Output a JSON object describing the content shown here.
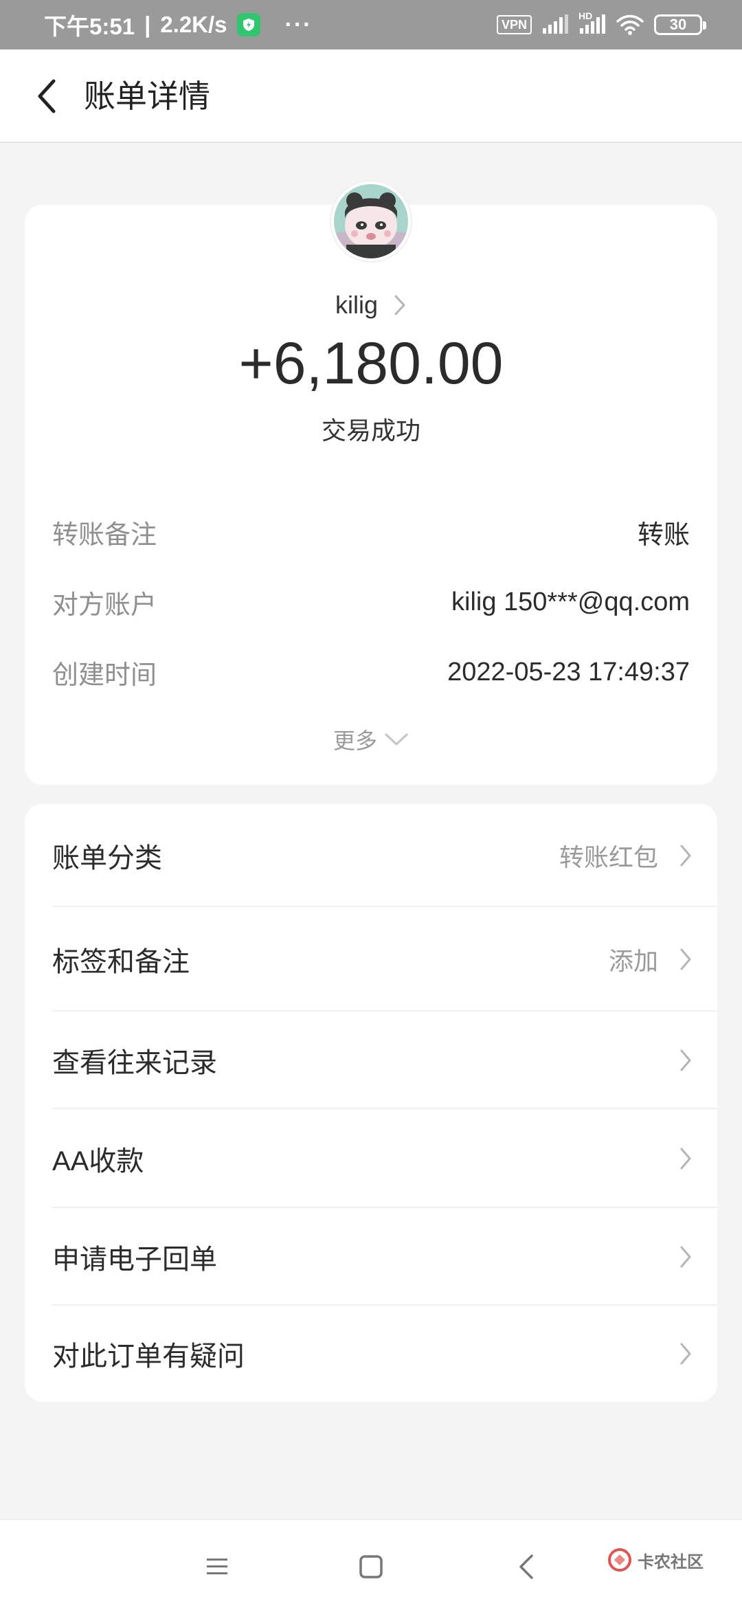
{
  "status_bar": {
    "time": "下午5:51",
    "speed": "2.2K/s",
    "vpn": "VPN",
    "hd": "HD",
    "battery": "30"
  },
  "header": {
    "title": "账单详情"
  },
  "summary": {
    "name": "kilig",
    "amount": "+6,180.00",
    "status": "交易成功"
  },
  "details": {
    "rows": [
      {
        "label": "转账备注",
        "value": "转账"
      },
      {
        "label": "对方账户",
        "value": "kilig 150***@qq.com"
      },
      {
        "label": "创建时间",
        "value": "2022-05-23 17:49:37"
      }
    ],
    "more": "更多"
  },
  "menu": {
    "items": [
      {
        "label": "账单分类",
        "value": "转账红包"
      },
      {
        "label": "标签和备注",
        "value": "添加"
      },
      {
        "label": "查看往来记录",
        "value": ""
      },
      {
        "label": "AA收款",
        "value": ""
      },
      {
        "label": "申请电子回单",
        "value": ""
      },
      {
        "label": "对此订单有疑问",
        "value": ""
      }
    ]
  },
  "watermark": {
    "name": "卡农社区"
  },
  "colors": {
    "status_bar": "#9a9a9a",
    "background": "#f4f4f4",
    "shield": "#2fc66f",
    "muted_text": "#8f8f8f",
    "watermark_accent": "#e0554f"
  },
  "icons": {
    "back": "chevron-left-icon",
    "row_arrow": "chevron-right-icon",
    "more": "chevron-down-icon",
    "nav_menu": "menu-icon",
    "nav_home": "square-icon",
    "nav_back": "triangle-back-icon"
  }
}
